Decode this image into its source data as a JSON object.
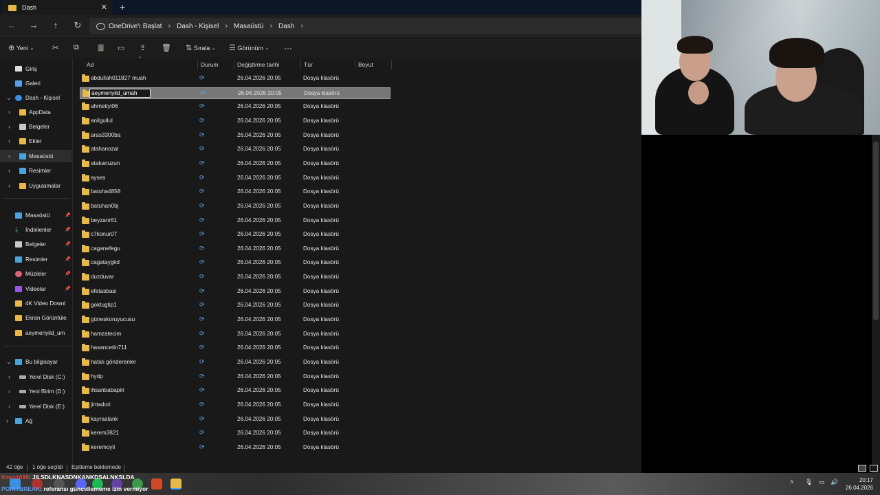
{
  "window": {
    "tab_title": "Dash",
    "tab_close": "✕",
    "new_tab": "+"
  },
  "breadcrumb": [
    "OneDrive'ı Başlat",
    "Dash - Kişisel",
    "Masaüstü",
    "Dash"
  ],
  "toolbar": {
    "new_label": "Yeni",
    "sort_label": "Sırala",
    "view_label": "Görünüm",
    "more": "···"
  },
  "columns": {
    "name": "Ad",
    "status": "Durum",
    "modified": "Değiştirme tarihi",
    "type": "Tür",
    "size": "Boyut"
  },
  "sidebar": {
    "top": [
      {
        "label": "Giriş",
        "icon": "home-icon"
      },
      {
        "label": "Galeri",
        "icon": "gallery-icon"
      },
      {
        "label": "Dash - Kişisel",
        "icon": "onedrive-icon"
      }
    ],
    "onedrive_children": [
      {
        "label": "AppData"
      },
      {
        "label": "Belgeler"
      },
      {
        "label": "Ekler"
      },
      {
        "label": "Masaüstü"
      },
      {
        "label": "Resimler"
      },
      {
        "label": "Uygulamalar"
      }
    ],
    "pinned": [
      {
        "label": "Masaüstü"
      },
      {
        "label": "İndirilenler"
      },
      {
        "label": "Belgeler"
      },
      {
        "label": "Resimler"
      },
      {
        "label": "Müzikler"
      },
      {
        "label": "Videolar"
      },
      {
        "label": "4K Video Downl"
      },
      {
        "label": "Ekran Görüntüle"
      },
      {
        "label": "aeymenyild_um"
      }
    ],
    "this_pc": "Bu bilgisayar",
    "drives": [
      {
        "label": "Yerel Disk (C:)"
      },
      {
        "label": "Yeni Birim (D:)"
      },
      {
        "label": "Yerel Disk (E:)"
      }
    ],
    "network": "Ağ"
  },
  "files": [
    {
      "name": "abdullah011827 muah",
      "date": "26.04.2026 20:05",
      "type": "Dosya klasörü"
    },
    {
      "name": "aeymenyild_umah",
      "date": "26.04.2026 20:05",
      "type": "Dosya klasörü",
      "selected": true
    },
    {
      "name": "ahmetiyi06",
      "date": "26.04.2026 20:05",
      "type": "Dosya klasörü"
    },
    {
      "name": "anilgullul",
      "date": "26.04.2026 20:05",
      "type": "Dosya klasörü"
    },
    {
      "name": "aras3300ba",
      "date": "26.04.2026 20:05",
      "type": "Dosya klasörü"
    },
    {
      "name": "atahanozal",
      "date": "26.04.2026 20:05",
      "type": "Dosya klasörü"
    },
    {
      "name": "atakanuzun",
      "date": "26.04.2026 20:05",
      "type": "Dosya klasörü"
    },
    {
      "name": "ayses",
      "date": "26.04.2026 20:05",
      "type": "Dosya klasörü"
    },
    {
      "name": "batuha4858",
      "date": "26.04.2026 20:05",
      "type": "Dosya klasörü"
    },
    {
      "name": "batuhan0bj",
      "date": "26.04.2026 20:05",
      "type": "Dosya klasörü"
    },
    {
      "name": "beyzanr61",
      "date": "26.04.2026 20:05",
      "type": "Dosya klasörü"
    },
    {
      "name": "c7konur07",
      "date": "26.04.2026 20:05",
      "type": "Dosya klasörü"
    },
    {
      "name": "caganefegu",
      "date": "26.04.2026 20:05",
      "type": "Dosya klasörü"
    },
    {
      "name": "cagataygkd",
      "date": "26.04.2026 20:05",
      "type": "Dosya klasörü"
    },
    {
      "name": "duzduvar",
      "date": "26.04.2026 20:05",
      "type": "Dosya klasörü"
    },
    {
      "name": "efetasbasi",
      "date": "26.04.2026 20:05",
      "type": "Dosya klasörü"
    },
    {
      "name": "goktugtip1",
      "date": "26.04.2026 20:05",
      "type": "Dosya klasörü"
    },
    {
      "name": "güneskoruyucusu",
      "date": "26.04.2026 20:05",
      "type": "Dosya klasörü"
    },
    {
      "name": "hamzatecim",
      "date": "26.04.2026 20:05",
      "type": "Dosya klasörü"
    },
    {
      "name": "hasancetin711",
      "date": "26.04.2026 20:05",
      "type": "Dosya klasörü"
    },
    {
      "name": "hatalı gönderenler",
      "date": "26.04.2026 20:05",
      "type": "Dosya klasörü"
    },
    {
      "name": "hydp",
      "date": "26.04.2026 20:05",
      "type": "Dosya klasörü"
    },
    {
      "name": "ihsanbabapiri",
      "date": "26.04.2026 20:05",
      "type": "Dosya klasörü"
    },
    {
      "name": "jintadori",
      "date": "26.04.2026 20:05",
      "type": "Dosya klasörü"
    },
    {
      "name": "kayraalank",
      "date": "26.04.2026 20:05",
      "type": "Dosya klasörü"
    },
    {
      "name": "kerem3821",
      "date": "26.04.2026 20:05",
      "type": "Dosya klasörü"
    },
    {
      "name": "keremoyil",
      "date": "26.04.2026 20:05",
      "type": "Dosya klasörü"
    }
  ],
  "status": {
    "count": "42 öğe",
    "selected": "1 öğe seçildi",
    "sync": "Eşitleme beklemede"
  },
  "chat": [
    {
      "user": "ilmro1698",
      "message": ": JILSDLKNASDNKANKDSALNKSLDA"
    },
    {
      "user": "POINTBREAK",
      "message": ": referansı güncellememe izin vermiyor"
    }
  ],
  "clock": {
    "time": "20:17",
    "date": "26.04.2026"
  },
  "colors": {
    "folder": "#e8b84a",
    "sync": "#5aa2e8",
    "accent": "#4fa0ff"
  }
}
